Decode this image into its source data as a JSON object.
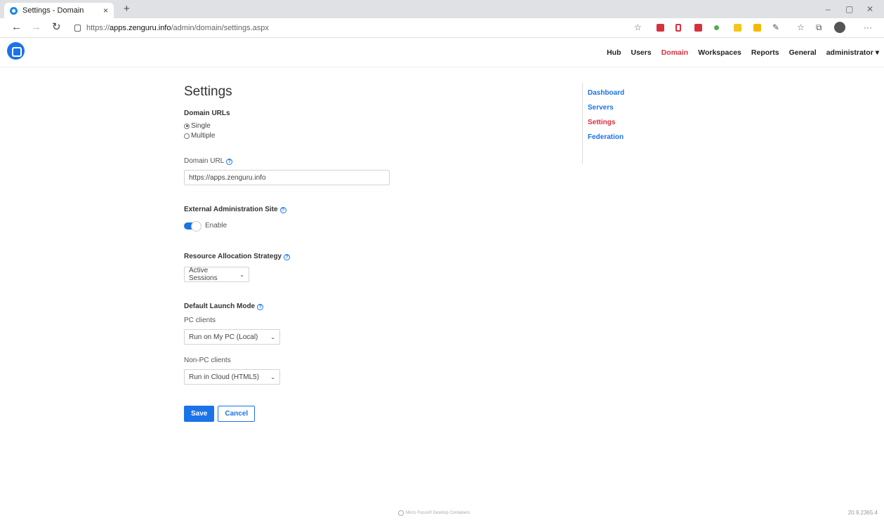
{
  "browser": {
    "tab_title": "Settings - Domain",
    "tab_close": "×",
    "new_tab": "+",
    "url_prefix": "https://",
    "url_host": "apps.zenguru.info",
    "url_path": "/admin/domain/settings.aspx",
    "controls": {
      "minimize": "–",
      "restore": "▢",
      "close": "✕"
    }
  },
  "nav": {
    "items": [
      "Hub",
      "Users",
      "Domain",
      "Workspaces",
      "Reports",
      "General"
    ],
    "active": "Domain",
    "user": "administrator ▾"
  },
  "form": {
    "title": "Settings",
    "domain_urls_label": "Domain URLs",
    "radio_single": "Single",
    "radio_multiple": "Multiple",
    "selected_option": "Single",
    "domain_url_label": "Domain URL",
    "domain_url_value": "https://apps.zenguru.info",
    "external_admin_label": "External Administration Site",
    "enable_label": "Enable",
    "enable_state": true,
    "resource_strategy_label": "Resource Allocation Strategy",
    "resource_strategy_value": "Active Sessions",
    "launch_mode_label": "Default Launch Mode",
    "pc_clients_label": "PC clients",
    "pc_clients_value": "Run on My PC (Local)",
    "nonpc_clients_label": "Non-PC clients",
    "nonpc_clients_value": "Run in Cloud (HTML5)",
    "save_label": "Save",
    "cancel_label": "Cancel",
    "help_glyph": "?"
  },
  "sidenav": {
    "items": [
      "Dashboard",
      "Servers",
      "Settings",
      "Federation"
    ],
    "active": "Settings"
  },
  "footer": {
    "brand": "Micro Focus® Desktop Containers",
    "version": "20.9.2365.4"
  },
  "colors": {
    "accent": "#1a73e8",
    "active_nav": "#d9303e"
  }
}
